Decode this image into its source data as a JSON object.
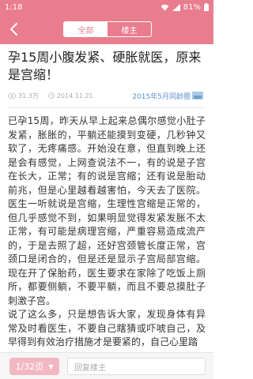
{
  "status": {
    "time": "1:18",
    "battery": "81%"
  },
  "nav": {
    "tab_all": "全部",
    "tab_op": "楼主"
  },
  "post": {
    "title": "孕15周小腹发紧、硬胀就医，原来是宫缩！",
    "views": "31.3万",
    "date": "2014.11.21",
    "cover_link": "2015年5月同龄圈",
    "body": "已孕15周，昨天从早上起来总偶尔感觉小肚子发紧，胀胀的，平躺还能摸到变硬，几秒钟又软了，无疼痛感。开始没在意，但直到晚上还是会有感觉，上网查说法不一，有的说是子宫在长大，正常；有的说是宫缩；还有说是胎动前兆，但是心里越看越害怕，今天去了医院。医生一听就说是宫缩，生理性宫缩是正常的，但几乎感觉不到，如果明显觉得发紧发胀不太正常，有可能是病理宫缩，严重容易造成流产的，于是去照了超，还好宫颈管长度正常，宫颈口是闭合的，但是还是显示子宫局部宫缩。现在开了保胎药，医生要求在家除了吃饭上厕所，都要侧躺，不要平躺，而且不要总摸肚子刺激子宫。\n说了这么多，只是想告诉大家，发现身体有异常及时看医生，不要自己瞎猜或吓唬自己，及早得到有效治疗措施才是要紧的，自己心里踏"
  },
  "bottom": {
    "page": "1/32页",
    "reply_placeholder": "回复楼主"
  },
  "colors": {
    "accent": "#e97d8e",
    "link": "#5b8fd0"
  }
}
